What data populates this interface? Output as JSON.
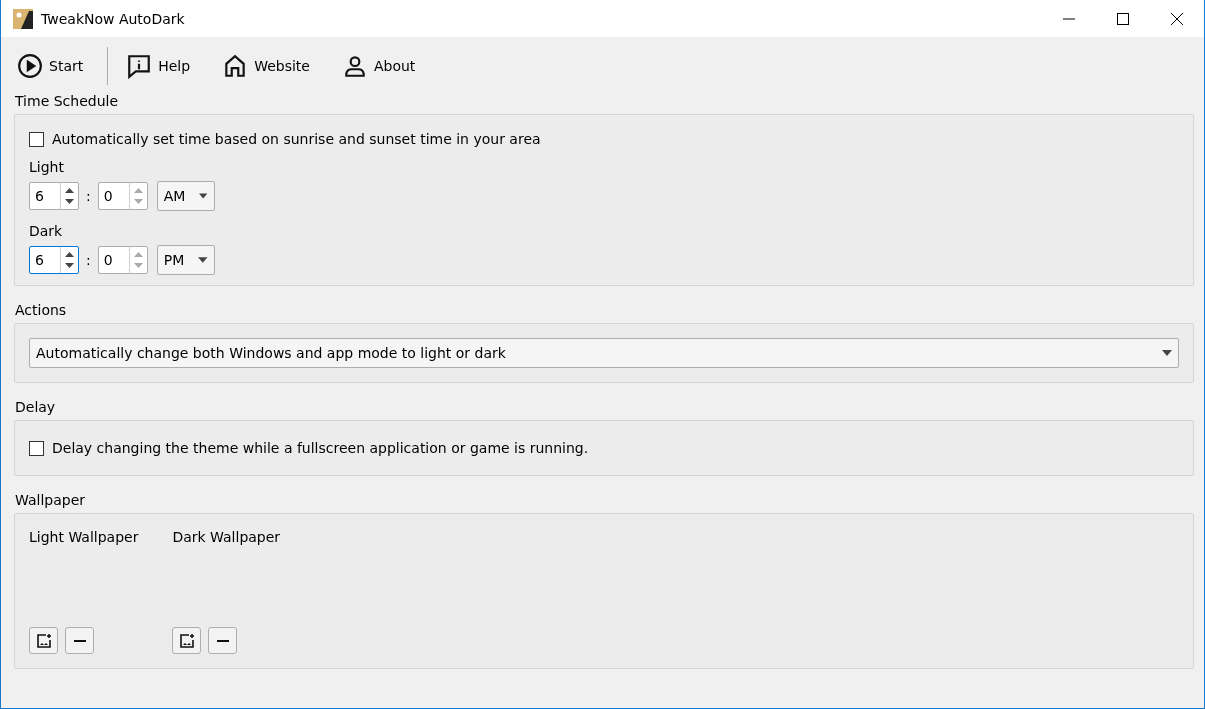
{
  "window": {
    "title": "TweakNow AutoDark"
  },
  "toolbar": [
    {
      "kind": "start",
      "label": "Start"
    },
    {
      "kind": "help",
      "label": "Help"
    },
    {
      "kind": "website",
      "label": "Website"
    },
    {
      "kind": "about",
      "label": "About"
    }
  ],
  "time_schedule": {
    "label": "Time Schedule",
    "auto_checkbox": {
      "label": "Automatically set time based on sunrise and sunset time in your area",
      "checked": false
    },
    "times": [
      {
        "label": "Light",
        "hour": {
          "value": "6",
          "focused": false,
          "arrows_enabled": true
        },
        "separator": ":",
        "minute": {
          "value": "0",
          "focused": false,
          "arrows_enabled": false
        },
        "period": "AM"
      },
      {
        "label": "Dark",
        "hour": {
          "value": "6",
          "focused": true,
          "arrows_enabled": true
        },
        "separator": ":",
        "minute": {
          "value": "0",
          "focused": false,
          "arrows_enabled": false
        },
        "period": "PM"
      }
    ]
  },
  "actions": {
    "label": "Actions",
    "value": "Automatically change both Windows and app mode to light or dark"
  },
  "delay": {
    "label": "Delay",
    "checkbox": {
      "label": "Delay changing the theme while a fullscreen application or game is running.",
      "checked": false
    }
  },
  "wallpaper": {
    "label": "Wallpaper",
    "columns": [
      {
        "label": "Light Wallpaper"
      },
      {
        "label": "Dark Wallpaper"
      }
    ]
  }
}
